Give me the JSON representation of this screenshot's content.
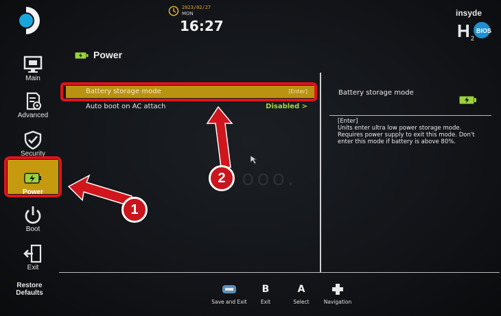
{
  "header": {
    "date": "2023/02/27",
    "day": "MON",
    "time": "16:27",
    "brand_top": "insyde",
    "brand_main": "H2O",
    "brand_sub": "BIOS"
  },
  "sidebar": {
    "items": [
      {
        "label": "Main",
        "icon": "monitor-icon"
      },
      {
        "label": "Advanced",
        "icon": "document-gear-icon"
      },
      {
        "label": "Security",
        "icon": "shield-check-icon"
      },
      {
        "label": "Power",
        "icon": "battery-icon",
        "selected": true
      },
      {
        "label": "Boot",
        "icon": "power-icon"
      },
      {
        "label": "Exit",
        "icon": "exit-door-icon"
      }
    ],
    "restore_label_1": "Restore",
    "restore_label_2": "Defaults"
  },
  "page": {
    "title": "Power",
    "icon": "battery-icon"
  },
  "settings": [
    {
      "label": "Battery storage mode",
      "value": "[Enter]",
      "selected": true
    },
    {
      "label": "Auto boot on AC attach",
      "value": "Disabled >"
    }
  ],
  "help": {
    "title": "Battery storage mode",
    "lines": [
      "[Enter]",
      "Units enter ultra low power storage mode.",
      "Requires power supply to exit this mode. Don't",
      "enter this mode if battery is above 80%."
    ]
  },
  "controls": [
    {
      "key": "",
      "icon": "keyboard-icon",
      "label": "Save and Exit"
    },
    {
      "key": "B",
      "label": "Exit"
    },
    {
      "key": "A",
      "label": "Select"
    },
    {
      "key": "",
      "icon": "dpad-icon",
      "label": "Navigation"
    }
  ],
  "annotations": {
    "badge_1": "1",
    "badge_2": "2"
  },
  "colors": {
    "accent_yellow": "#b99211",
    "highlight_red": "#e1141b",
    "value_green": "#a6d64a",
    "battery_green": "#9bd33b"
  }
}
